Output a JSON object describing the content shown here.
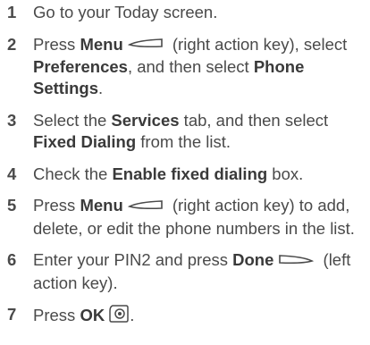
{
  "steps": [
    {
      "num": "1",
      "t1": "Go to your Today screen."
    },
    {
      "num": "2",
      "t1": "Press ",
      "b1": "Menu",
      "t2": " (right action key), select ",
      "b2": "Preferences",
      "t3": ", and then select ",
      "b3": "Phone Settings",
      "t4": "."
    },
    {
      "num": "3",
      "t1": "Select the ",
      "b1": "Services",
      "t2": " tab, and then select ",
      "b2": "Fixed Dialing",
      "t3": " from the list."
    },
    {
      "num": "4",
      "t1": "Check the ",
      "b1": "Enable fixed dialing",
      "t2": " box."
    },
    {
      "num": "5",
      "t1": "Press ",
      "b1": "Menu",
      "t2": " (right action key) to add, delete, or edit the phone numbers in the list."
    },
    {
      "num": "6",
      "t1": "Enter your PIN2 and press ",
      "b1": "Done",
      "t2": " (left action key)."
    },
    {
      "num": "7",
      "t1": "Press ",
      "b1": "OK",
      "t2": "."
    }
  ],
  "icons": {
    "right_action_key": "right-action-key-icon",
    "left_action_key": "left-action-key-icon",
    "ok_key": "ok-key-icon"
  }
}
